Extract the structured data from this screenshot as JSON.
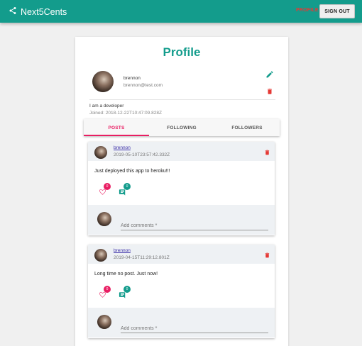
{
  "app": {
    "name": "Next5Cents",
    "nav": {
      "profile_label": "PROFILE",
      "signout_label": "SIGN OUT"
    },
    "colors": {
      "primary": "#139c8c",
      "accent": "#e91e63",
      "danger": "#e53935"
    }
  },
  "profile": {
    "title": "Profile",
    "name": "brennon",
    "email": "brennon@test.com",
    "about": "I am a developer",
    "joined": "Joined: 2018-12-22T10:47:09.828Z",
    "icons": {
      "edit": "pencil-icon",
      "delete": "trash-icon"
    }
  },
  "tabs": [
    {
      "label": "POSTS",
      "active": true
    },
    {
      "label": "FOLLOWING",
      "active": false
    },
    {
      "label": "FOLLOWERS",
      "active": false
    }
  ],
  "posts": [
    {
      "author": "brennon",
      "date": "2019-05-10T23:57:42.332Z",
      "text": "Just deployed this app to heroku!!!",
      "likes": "0",
      "comments": "0",
      "comment_placeholder": "Add comments *"
    },
    {
      "author": "brennon",
      "date": "2019-04-15T11:29:12.801Z",
      "text": "Long time no post. Just now!",
      "likes": "0",
      "comments": "0",
      "comment_placeholder": "Add comments *"
    }
  ]
}
